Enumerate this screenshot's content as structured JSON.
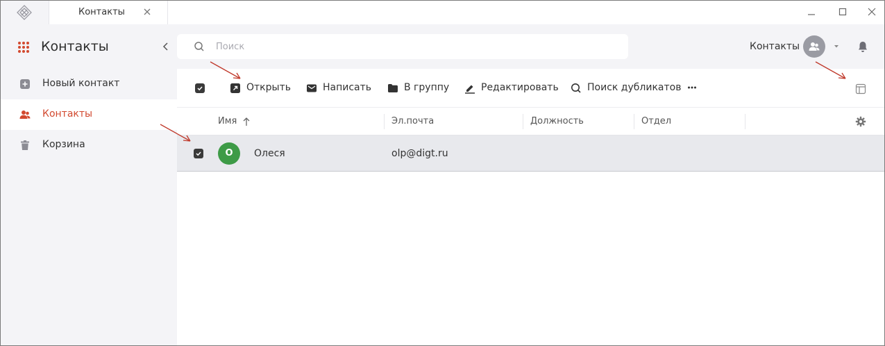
{
  "window": {
    "tab_label": "Контакты"
  },
  "sidebar": {
    "title": "Контакты",
    "items": [
      {
        "label": "Новый контакт",
        "icon": "plus-square-icon"
      },
      {
        "label": "Контакты",
        "icon": "contacts-icon",
        "active": true
      },
      {
        "label": "Корзина",
        "icon": "trash-icon"
      }
    ]
  },
  "header": {
    "search_placeholder": "Поиск",
    "section_label": "Контакты"
  },
  "toolbar": {
    "open": "Открыть",
    "write": "Написать",
    "to_group": "В группу",
    "edit": "Редактировать",
    "find_duplicates": "Поиск дубликатов"
  },
  "table": {
    "columns": [
      "Имя",
      "Эл.почта",
      "Должность",
      "Отдел"
    ],
    "sort": "asc",
    "rows": [
      {
        "initial": "О",
        "name": "Олеся",
        "email": "olp@digt.ru",
        "position": "",
        "department": "",
        "selected": true
      }
    ]
  },
  "colors": {
    "accent": "#d2492f",
    "avatar_green": "#3e9b47",
    "row_selected": "#e8e9ed",
    "arrow": "#c0392b"
  }
}
